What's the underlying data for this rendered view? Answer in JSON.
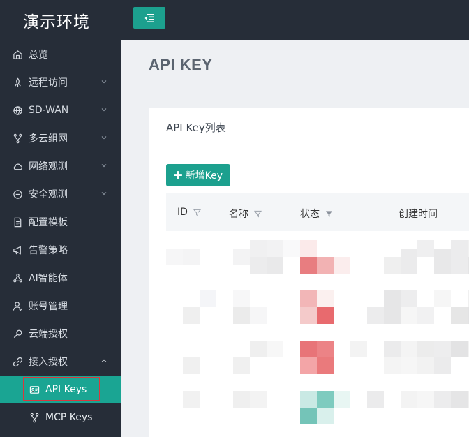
{
  "app": {
    "title": "演示环境"
  },
  "sidebar": {
    "items": [
      {
        "label": "总览",
        "icon": "home-icon",
        "chevron": false
      },
      {
        "label": "远程访问",
        "icon": "rocket-icon",
        "chevron": true
      },
      {
        "label": "SD-WAN",
        "icon": "globe-icon",
        "chevron": true
      },
      {
        "label": "多云组网",
        "icon": "branch-icon",
        "chevron": true
      },
      {
        "label": "网络观测",
        "icon": "cloud-icon",
        "chevron": true
      },
      {
        "label": "安全观测",
        "icon": "minus-circle-icon",
        "chevron": true
      },
      {
        "label": "配置模板",
        "icon": "document-icon",
        "chevron": false
      },
      {
        "label": "告警策略",
        "icon": "megaphone-icon",
        "chevron": false
      },
      {
        "label": "AI智能体",
        "icon": "nodes-icon",
        "chevron": false
      },
      {
        "label": "账号管理",
        "icon": "user-icon",
        "chevron": false
      },
      {
        "label": "云端授权",
        "icon": "key-icon",
        "chevron": false
      },
      {
        "label": "接入授权",
        "icon": "link-icon",
        "chevron": true,
        "expanded": true
      }
    ],
    "sub_items": [
      {
        "label": "API Keys",
        "icon": "id-card-icon",
        "active": true
      },
      {
        "label": "MCP Keys",
        "icon": "branch-icon",
        "active": false
      }
    ]
  },
  "page": {
    "title": "API KEY"
  },
  "card": {
    "title": "API Key列表",
    "add_button": "新增Key"
  },
  "table": {
    "columns": [
      "ID",
      "名称",
      "状态",
      "创建时间"
    ]
  },
  "colors": {
    "sidebar_bg": "#262d38",
    "accent": "#1ca08e",
    "highlight_border": "#d9383e"
  }
}
